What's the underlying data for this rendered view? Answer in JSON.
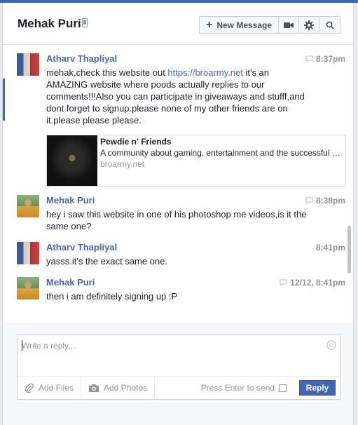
{
  "header": {
    "title": "Mehak Puri",
    "new_message_label": "New Message"
  },
  "messages": [
    {
      "sender": "Atharv Thapliyal",
      "time": "8:37pm",
      "text_before_link": "mehak,check this website out ",
      "link_text": "https://broarmy.net",
      "text_after_link": " it's an AMAZING website where poods actually replies to our comments!!!Also you can participate in giveaways and stufff,and dont forget to signup.please none of my other friends are on it.please please please.",
      "link_card": {
        "title": "Pewdie n' Friends",
        "description": "A community about gaming, entertainment and the successful youtuber PewDiePie",
        "domain": "broarmy.net"
      }
    },
    {
      "sender": "Mehak Puri",
      "time": "8:38pm",
      "text": "hey i saw this website in one of his photoshop me videos,is it the same one?"
    },
    {
      "sender": "Atharv Thapliyal",
      "time": "8:41pm",
      "text": "yasss.it's the exact same one."
    },
    {
      "sender": "Mehak Puri",
      "time": "12/12, 8:41pm",
      "text": "then i am definitely signing up :P"
    }
  ],
  "composer": {
    "placeholder": "Write a reply...",
    "add_files_label": "Add Files",
    "add_photos_label": "Add Photos",
    "press_enter_label": "Press Enter to send",
    "reply_label": "Reply"
  },
  "colors": {
    "accent": "#4267b2",
    "muted": "#90949c"
  }
}
